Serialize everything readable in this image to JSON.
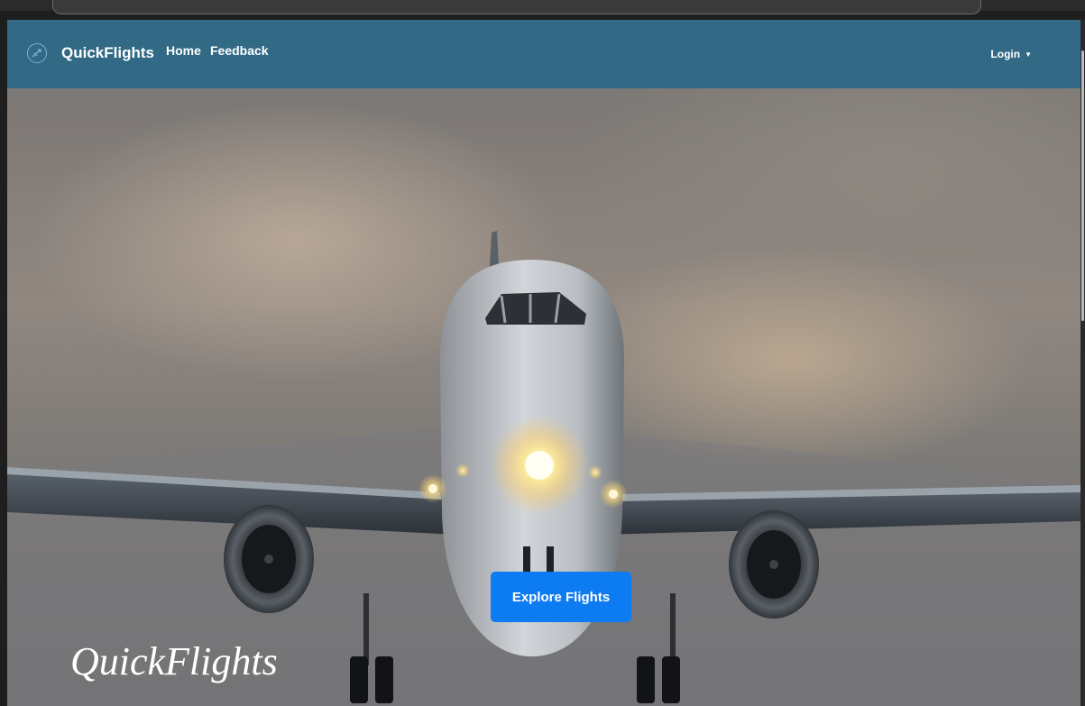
{
  "navbar": {
    "brand": "QuickFlights",
    "links": [
      "Home",
      "Feedback"
    ],
    "login": "Login"
  },
  "hero": {
    "cta": "Explore Flights",
    "title": "QuickFlights"
  },
  "colors": {
    "navbar_bg": "#326a86",
    "cta_bg": "#0d7bf2"
  },
  "icons": {
    "brand": "plane-logo-icon",
    "login_dropdown": "caret-down-icon"
  }
}
